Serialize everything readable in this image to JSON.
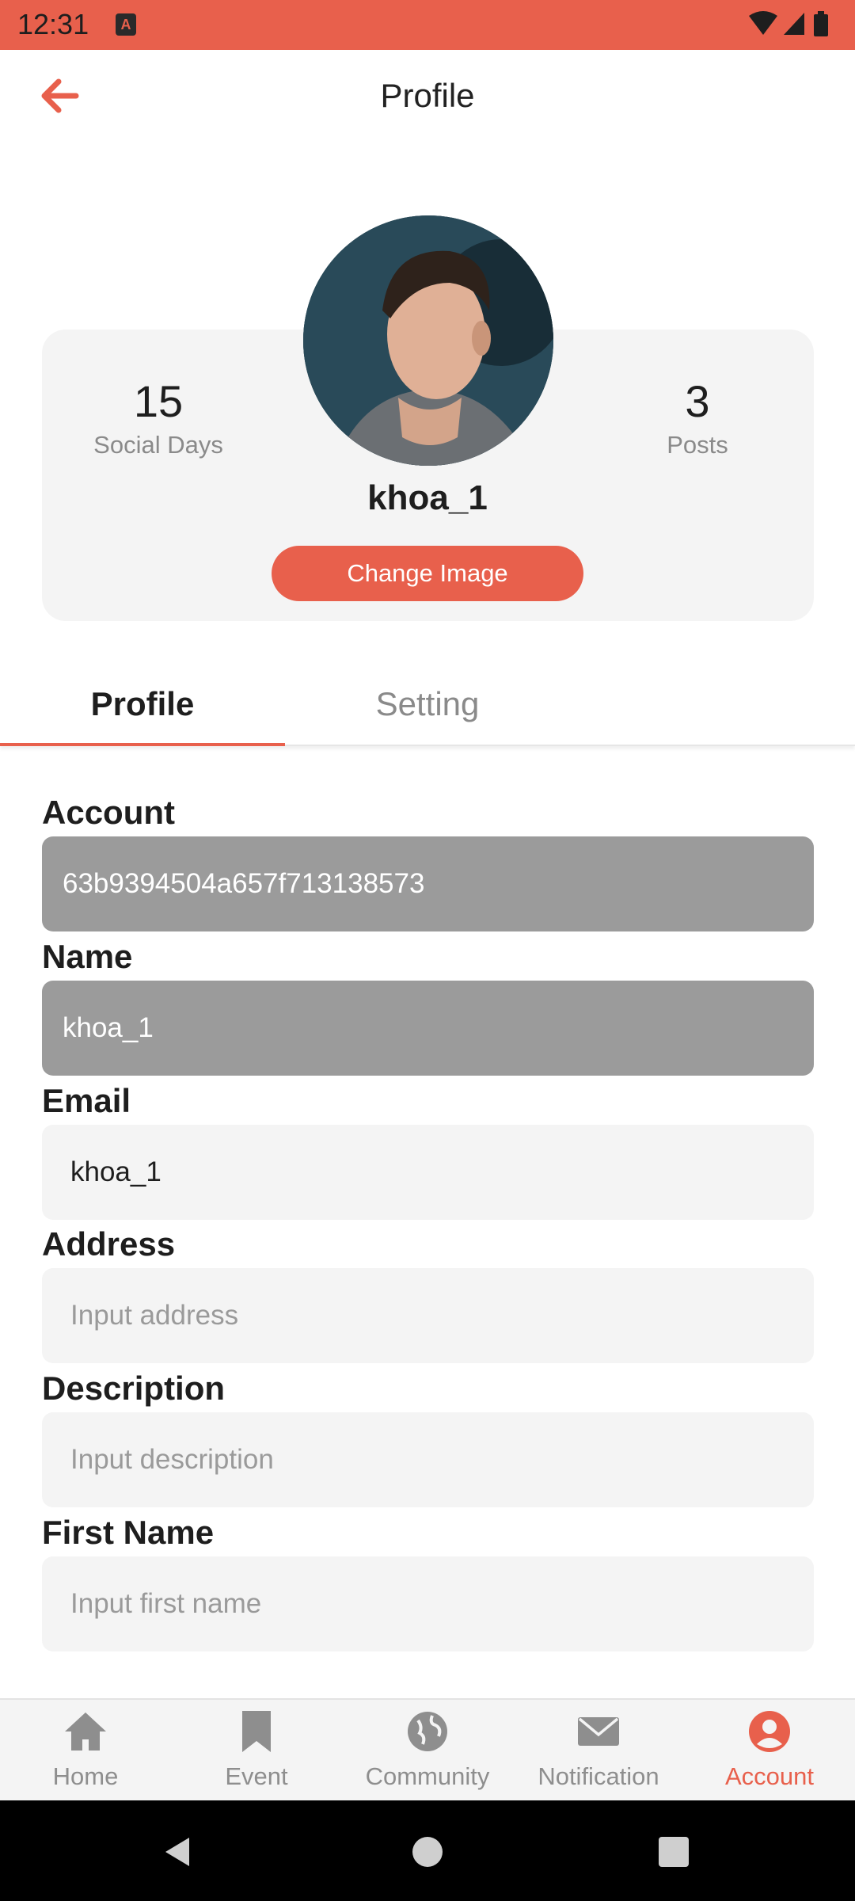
{
  "status_bar": {
    "time": "12:31",
    "app_badge": "A"
  },
  "app_bar": {
    "title": "Profile"
  },
  "profile_card": {
    "stat_left": {
      "value": "15",
      "label": "Social Days"
    },
    "stat_right": {
      "value": "3",
      "label": "Posts"
    },
    "username": "khoa_1",
    "change_image_label": "Change Image"
  },
  "tabs": [
    {
      "label": "Profile",
      "active": true
    },
    {
      "label": "Setting",
      "active": false
    }
  ],
  "form": {
    "account": {
      "label": "Account",
      "value": "63b9394504a657f713138573"
    },
    "name": {
      "label": "Name",
      "value": "khoa_1"
    },
    "email": {
      "label": "Email",
      "value": "khoa_1"
    },
    "address": {
      "label": "Address",
      "placeholder": "Input address"
    },
    "description": {
      "label": "Description",
      "placeholder": "Input description"
    },
    "first_name": {
      "label": "First Name",
      "placeholder": "Input first name"
    }
  },
  "bottom_nav": [
    {
      "label": "Home",
      "icon": "home-icon"
    },
    {
      "label": "Event",
      "icon": "bookmark-icon"
    },
    {
      "label": "Community",
      "icon": "globe-icon"
    },
    {
      "label": "Notification",
      "icon": "envelope-icon"
    },
    {
      "label": "Account",
      "icon": "account-icon",
      "active": true
    }
  ],
  "colors": {
    "accent": "#e8604c",
    "card_bg": "#f4f4f4",
    "disabled_field": "#9b9b9b"
  }
}
